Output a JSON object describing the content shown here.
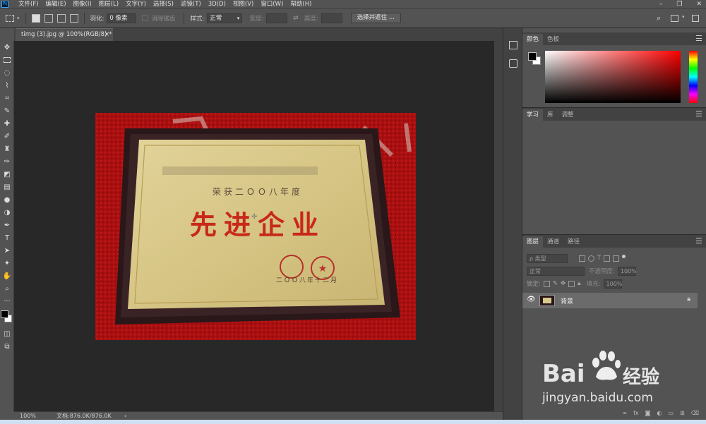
{
  "app": {
    "logo": "Ps"
  },
  "menu": [
    "文件(F)",
    "编辑(E)",
    "图像(I)",
    "图层(L)",
    "文字(Y)",
    "选择(S)",
    "滤镜(T)",
    "3D(D)",
    "视图(V)",
    "窗口(W)",
    "帮助(H)"
  ],
  "window_controls": {
    "minimize": "–",
    "restore": "❐",
    "close": "✕"
  },
  "options": {
    "feather_label": "羽化:",
    "feather_value": "0 像素",
    "antialias_label": "消除锯齿",
    "style_label": "样式:",
    "style_value": "正常",
    "width_label": "宽度:",
    "height_label": "高度:",
    "select_mask_button": "选择并遮住 ..."
  },
  "document": {
    "tab_title": "timg (3).jpg @ 100%(RGB/8) *",
    "close": "×"
  },
  "image": {
    "line1": "荣获二ＯＯ八年度",
    "line2": "先进企业",
    "date": "二ＯＯ八年十二月"
  },
  "status": {
    "zoom": "100%",
    "doc_info": "文档:876.0K/876.0K",
    "arrow": "›"
  },
  "color_panel": {
    "tabs": [
      "颜色",
      "色板"
    ],
    "foreground": "#000000",
    "background": "#ffffff"
  },
  "learn_panel": {
    "tabs": [
      "学习",
      "库",
      "调整"
    ]
  },
  "layers_panel": {
    "tabs": [
      "图层",
      "通道",
      "路径"
    ],
    "kind_placeholder": "ρ 类型",
    "blend_mode": "正常",
    "opacity_label": "不透明度:",
    "opacity_value": "100%",
    "lock_label": "锁定:",
    "fill_label": "填充:",
    "fill_value": "100%",
    "layer_name": "背景"
  },
  "watermark": {
    "brand": "Bai",
    "brand2": "经验",
    "url": "jingyan.baidu.com"
  },
  "colors": {
    "accent": "#31a8ff",
    "canvas_bg": "#282828",
    "panel_bg": "#535353",
    "red_carpet": "#b01010",
    "plaque_gold": "#d9c88a",
    "plaque_frame": "#2b1a1a",
    "title_red": "#c8281c"
  }
}
